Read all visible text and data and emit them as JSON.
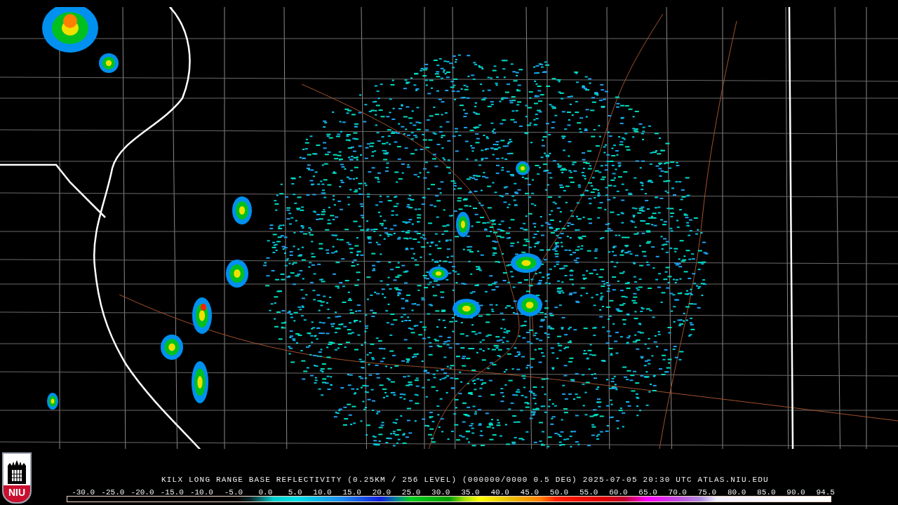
{
  "logo": {
    "text": "NIU"
  },
  "caption": "KILX LONG RANGE BASE REFLECTIVITY (0.25KM / 256 LEVEL) (000000/0000 0.5 DEG) 2025-07-05 20:30 UTC  ATLAS.NIU.EDU",
  "scale_labels": [
    "-30.0",
    "-25.0",
    "-20.0",
    "-15.0",
    "-10.0",
    "-5.0",
    "0.0",
    "5.0",
    "10.0",
    "15.0",
    "20.0",
    "25.0",
    "30.0",
    "35.0",
    "40.0",
    "45.0",
    "50.0",
    "55.0",
    "60.0",
    "65.0",
    "70.0",
    "75.0",
    "80.0",
    "85.0",
    "90.0",
    "94.5"
  ]
}
